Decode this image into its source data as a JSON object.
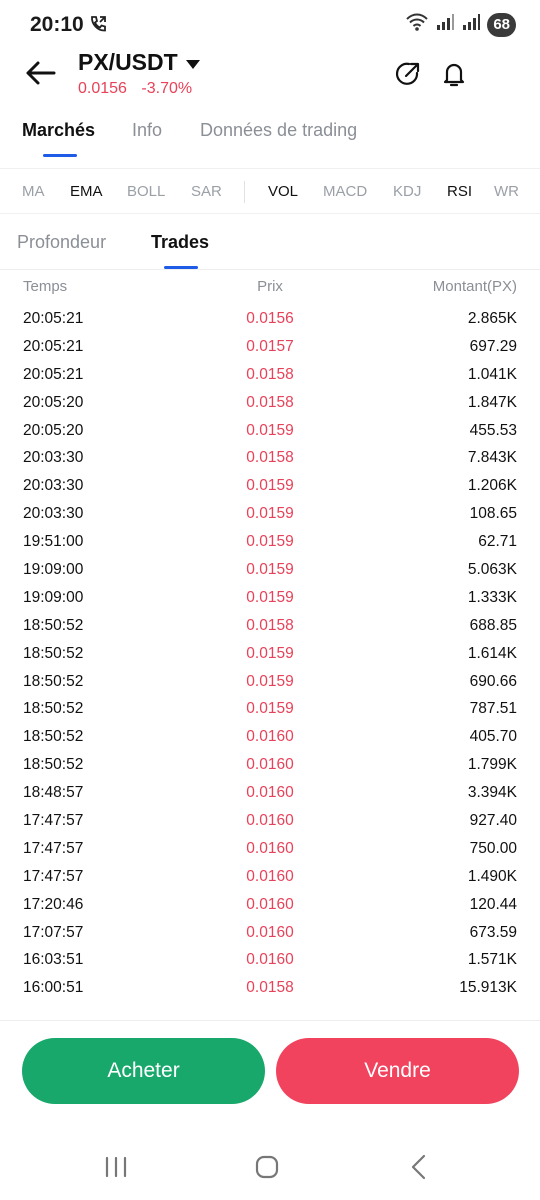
{
  "status_bar": {
    "time": "20:10",
    "battery": "68",
    "icons": [
      "call-forward-icon",
      "wifi-icon",
      "signal-icon",
      "signal-icon",
      "battery-icon"
    ]
  },
  "header": {
    "pair": "PX/USDT",
    "last_price": "0.0156",
    "change": "-3.70%",
    "colors": {
      "down": "#e74259",
      "accent": "#1e5be6"
    }
  },
  "tabs": [
    "Marchés",
    "Info",
    "Données de trading"
  ],
  "indicators": [
    "MA",
    "EMA",
    "BOLL",
    "SAR",
    "VOL",
    "MACD",
    "KDJ",
    "RSI",
    "WR"
  ],
  "subtabs": [
    "Profondeur",
    "Trades"
  ],
  "table": {
    "headers": {
      "time": "Temps",
      "price": "Prix",
      "amount": "Montant(PX)"
    },
    "rows": [
      {
        "time": "20:05:21",
        "price": "0.0156",
        "amount": "2.865K"
      },
      {
        "time": "20:05:21",
        "price": "0.0157",
        "amount": "697.29"
      },
      {
        "time": "20:05:21",
        "price": "0.0158",
        "amount": "1.041K"
      },
      {
        "time": "20:05:20",
        "price": "0.0158",
        "amount": "1.847K"
      },
      {
        "time": "20:05:20",
        "price": "0.0159",
        "amount": "455.53"
      },
      {
        "time": "20:03:30",
        "price": "0.0158",
        "amount": "7.843K"
      },
      {
        "time": "20:03:30",
        "price": "0.0159",
        "amount": "1.206K"
      },
      {
        "time": "20:03:30",
        "price": "0.0159",
        "amount": "108.65"
      },
      {
        "time": "19:51:00",
        "price": "0.0159",
        "amount": "62.71"
      },
      {
        "time": "19:09:00",
        "price": "0.0159",
        "amount": "5.063K"
      },
      {
        "time": "19:09:00",
        "price": "0.0159",
        "amount": "1.333K"
      },
      {
        "time": "18:50:52",
        "price": "0.0158",
        "amount": "688.85"
      },
      {
        "time": "18:50:52",
        "price": "0.0159",
        "amount": "1.614K"
      },
      {
        "time": "18:50:52",
        "price": "0.0159",
        "amount": "690.66"
      },
      {
        "time": "18:50:52",
        "price": "0.0159",
        "amount": "787.51"
      },
      {
        "time": "18:50:52",
        "price": "0.0160",
        "amount": "405.70"
      },
      {
        "time": "18:50:52",
        "price": "0.0160",
        "amount": "1.799K"
      },
      {
        "time": "18:48:57",
        "price": "0.0160",
        "amount": "3.394K"
      },
      {
        "time": "17:47:57",
        "price": "0.0160",
        "amount": "927.40"
      },
      {
        "time": "17:47:57",
        "price": "0.0160",
        "amount": "750.00"
      },
      {
        "time": "17:47:57",
        "price": "0.0160",
        "amount": "1.490K"
      },
      {
        "time": "17:20:46",
        "price": "0.0160",
        "amount": "120.44"
      },
      {
        "time": "17:07:57",
        "price": "0.0160",
        "amount": "673.59"
      },
      {
        "time": "16:03:51",
        "price": "0.0160",
        "amount": "1.571K"
      },
      {
        "time": "16:00:51",
        "price": "0.0158",
        "amount": "15.913K"
      }
    ]
  },
  "actions": {
    "buy": "Acheter",
    "sell": "Vendre",
    "buy_color": "#18a86b",
    "sell_color": "#f1425e"
  },
  "nav": [
    "recent-apps-icon",
    "home-icon",
    "back-icon"
  ]
}
